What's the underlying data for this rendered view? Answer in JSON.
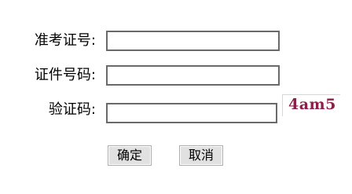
{
  "form": {
    "exam_id": {
      "label": "准考证号:",
      "value": ""
    },
    "id_number": {
      "label": "证件号码:",
      "value": ""
    },
    "captcha": {
      "label": "验证码:",
      "value": "",
      "image_text": "4am5"
    }
  },
  "buttons": {
    "confirm_label": "确定",
    "cancel_label": "取消"
  }
}
